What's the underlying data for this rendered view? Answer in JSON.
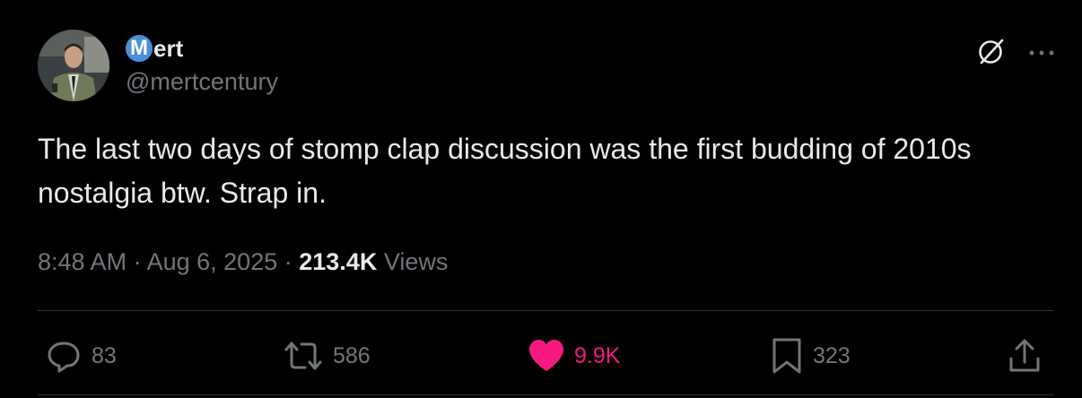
{
  "author": {
    "name_initial": "M",
    "name_rest": "ert",
    "handle": "@mertcentury"
  },
  "tweet": {
    "text": "The last two days of stomp clap discussion was the first budding of 2010s nostalgia btw. Strap in.",
    "time": "8:48 AM",
    "date": "Aug 6, 2025",
    "separator": "·",
    "views_count": "213.4K",
    "views_label": "Views"
  },
  "actions": {
    "replies": "83",
    "reposts": "586",
    "likes": "9.9K",
    "bookmarks": "323"
  },
  "icons": {
    "top": [
      "grok-icon",
      "more-icon"
    ],
    "actions": [
      "reply-icon",
      "repost-icon",
      "heart-icon",
      "bookmark-icon",
      "share-icon"
    ]
  },
  "colors": {
    "background": "#000000",
    "text": "#e7e9ea",
    "secondary": "#71767b",
    "like": "#f91880",
    "badge": "#4a8fd8",
    "divider": "#2f3336"
  }
}
